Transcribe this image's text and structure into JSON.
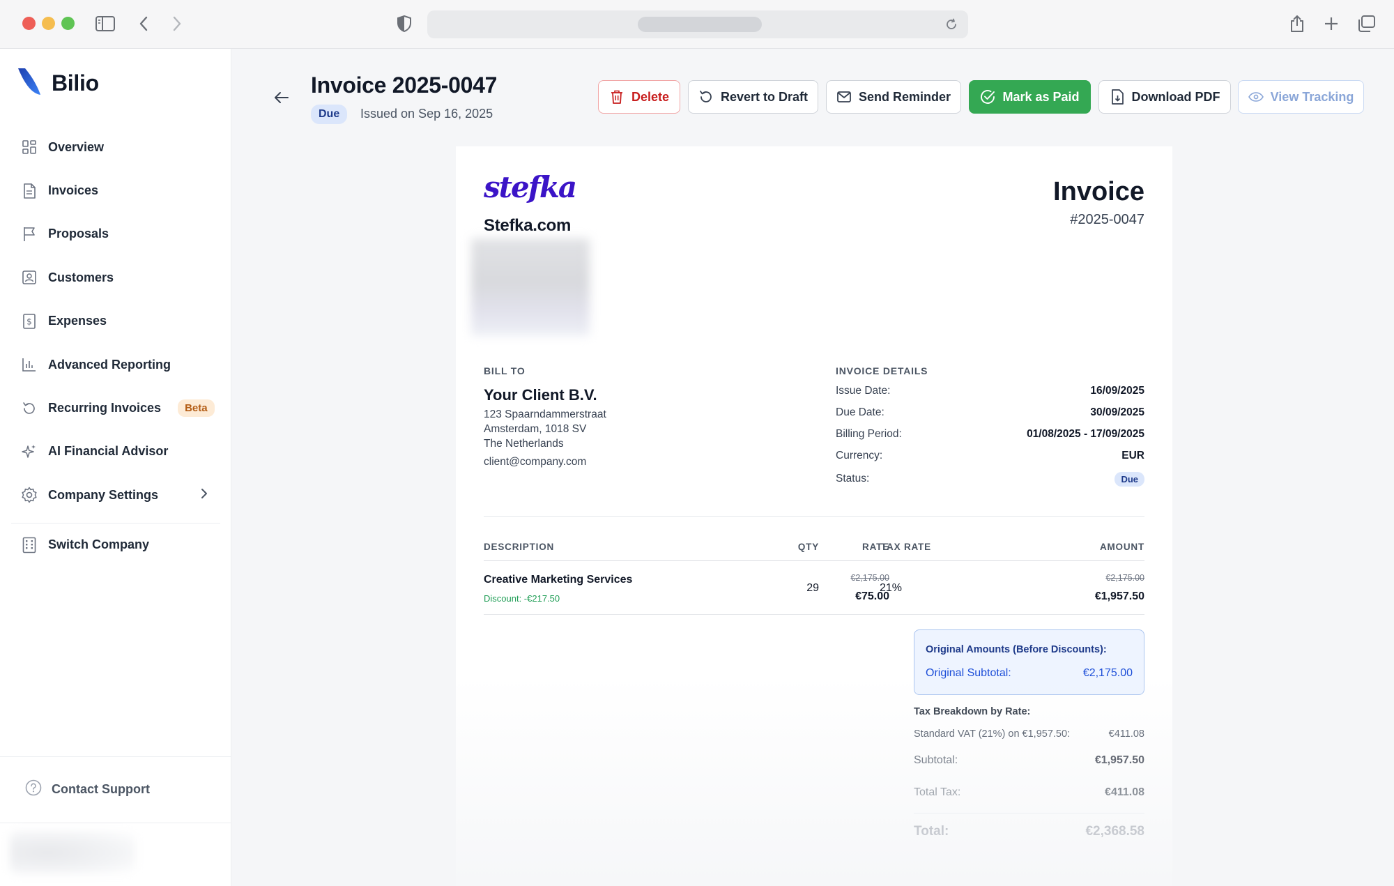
{
  "app": {
    "name": "Bilio"
  },
  "colors": {
    "brand_blue": "#1d4ed8",
    "paid_green": "#34a853",
    "delete_red": "#c81e1e",
    "logo_purple": "#3b14c7",
    "discount_green": "#1f9d55"
  },
  "sidebar": {
    "items": [
      {
        "label": "Overview",
        "icon": "grid-icon"
      },
      {
        "label": "Invoices",
        "icon": "document-icon"
      },
      {
        "label": "Proposals",
        "icon": "flag-icon"
      },
      {
        "label": "Customers",
        "icon": "contact-card-icon"
      },
      {
        "label": "Expenses",
        "icon": "receipt-dollar-icon"
      },
      {
        "label": "Advanced Reporting",
        "icon": "bar-chart-icon"
      },
      {
        "label": "Recurring Invoices",
        "icon": "refresh-icon",
        "badge": "Beta"
      },
      {
        "label": "AI Financial Advisor",
        "icon": "sparkles-icon"
      },
      {
        "label": "Company Settings",
        "icon": "gear-icon"
      },
      {
        "label": "Switch Company",
        "icon": "building-icon"
      }
    ],
    "support_label": "Contact Support"
  },
  "header": {
    "title": "Invoice 2025-0047",
    "status": "Due",
    "issued": "Issued on Sep 16, 2025"
  },
  "actions": {
    "delete": "Delete",
    "revert": "Revert to Draft",
    "reminder": "Send Reminder",
    "paid": "Mark as Paid",
    "pdf": "Download PDF",
    "tracking": "View Tracking"
  },
  "invoice": {
    "logo_text": "stefka",
    "company_name": "Stefka.com",
    "heading": "Invoice",
    "number": "#2025-0047",
    "bill_to": {
      "label": "BILL TO",
      "name": "Your Client B.V.",
      "street": "123 Spaarndammerstraat",
      "city": "Amsterdam, 1018 SV",
      "country": "The Netherlands",
      "email": "client@company.com"
    },
    "details": {
      "label": "INVOICE DETAILS",
      "issue_date_label": "Issue Date:",
      "issue_date": "16/09/2025",
      "due_date_label": "Due Date:",
      "due_date": "30/09/2025",
      "period_label": "Billing Period:",
      "period": "01/08/2025 - 17/09/2025",
      "currency_label": "Currency:",
      "currency": "EUR",
      "status_label": "Status:",
      "status": "Due"
    },
    "table": {
      "headers": {
        "description": "DESCRIPTION",
        "qty": "QTY",
        "rate": "RATE",
        "tax_rate": "TAX RATE",
        "amount": "AMOUNT"
      },
      "rows": [
        {
          "description": "Creative Marketing Services",
          "discount": "Discount: -€217.50",
          "qty": "29",
          "rate_original": "€2,175.00",
          "rate": "€75.00",
          "tax_rate": "21%",
          "amount_original": "€2,175.00",
          "amount": "€1,957.50"
        }
      ]
    },
    "original_box": {
      "title": "Original Amounts (Before Discounts):",
      "subtotal_label": "Original Subtotal:",
      "subtotal": "€2,175.00"
    },
    "tax_breakdown": {
      "title": "Tax Breakdown by Rate:",
      "line_label": "Standard VAT (21%) on €1,957.50:",
      "line_value": "€411.08"
    },
    "totals": {
      "subtotal_label": "Subtotal:",
      "subtotal": "€1,957.50",
      "tax_label": "Total Tax:",
      "tax": "€411.08",
      "total_label": "Total:",
      "total": "€2,368.58"
    }
  }
}
